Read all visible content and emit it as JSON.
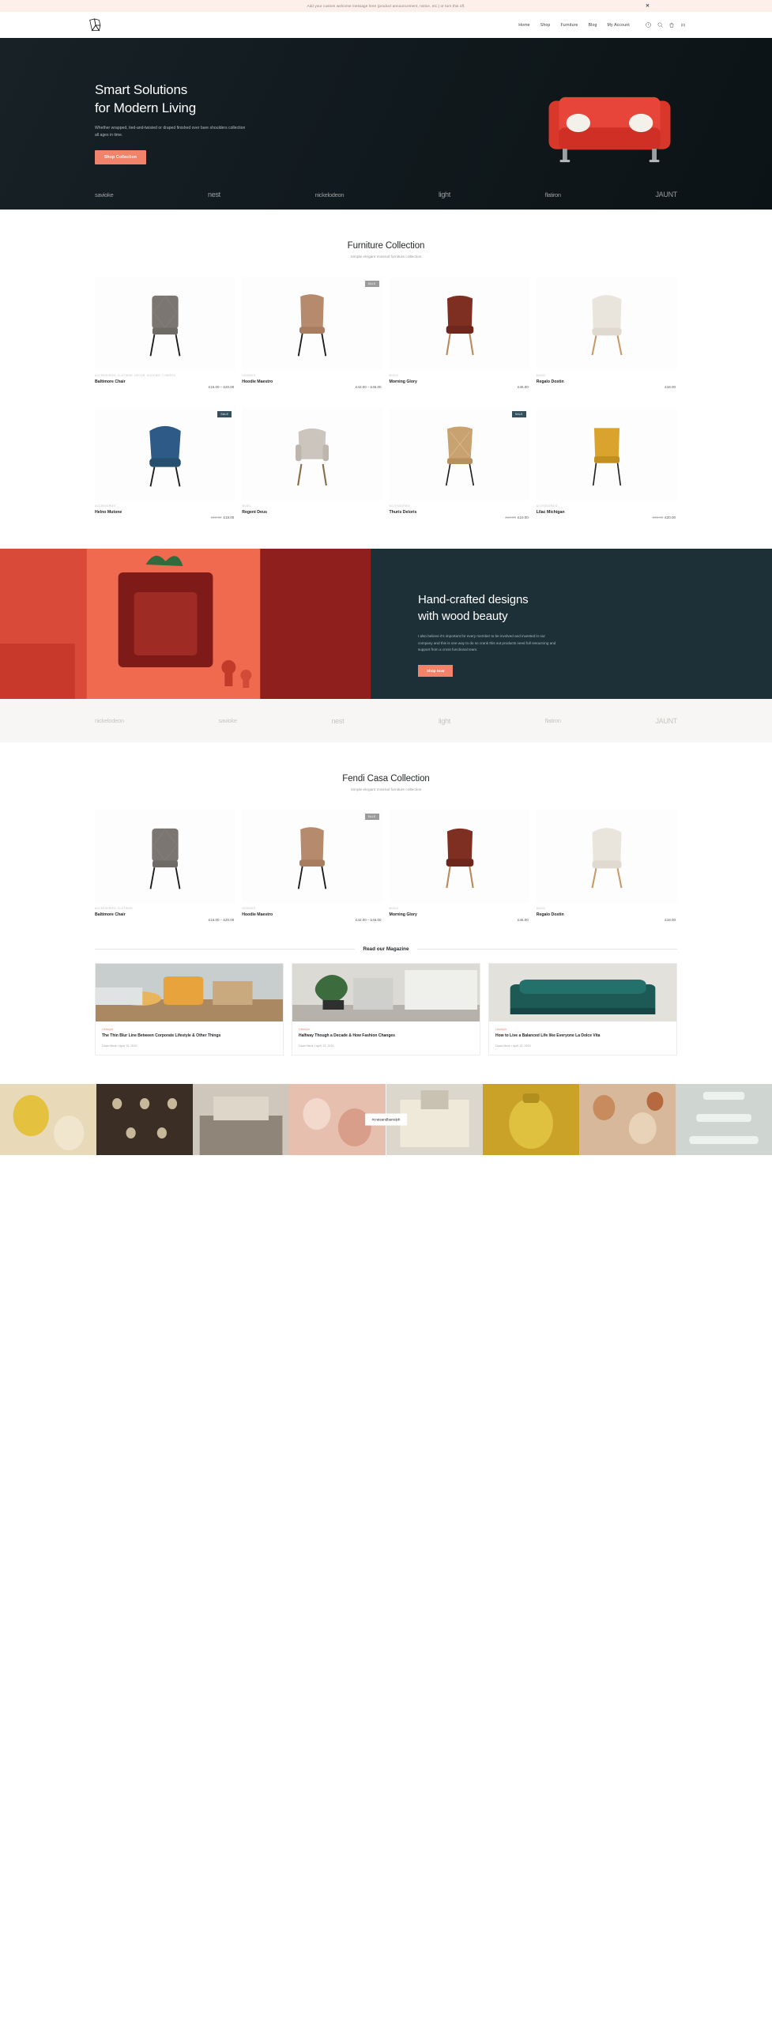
{
  "announcement": {
    "text": "Add your custom welcome message here (product announcement, notice, etc.) or turn this off.",
    "close_label": "✕"
  },
  "header": {
    "logo_name": "brand-logo",
    "nav": [
      {
        "label": "Home"
      },
      {
        "label": "Shop"
      },
      {
        "label": "Furniture"
      },
      {
        "label": "Blog"
      },
      {
        "label": "My Account"
      }
    ],
    "icons": [
      {
        "name": "help-icon"
      },
      {
        "name": "search-icon"
      },
      {
        "name": "cart-icon"
      }
    ],
    "cart_count": "(0)"
  },
  "hero": {
    "title_line1": "Smart Solutions",
    "title_line2": "for Modern Living",
    "subtitle": "Whether wrapped, tied-and-twisted or draped finished over bare shoulders collection all ages in time.",
    "button": "Shop Collection",
    "brands": [
      "savioke",
      "nest",
      "nickelodeon",
      "light",
      "flatiron",
      "JAUNT"
    ]
  },
  "collection1": {
    "title": "Furniture Collection",
    "subtitle": "Simple elegant minimal furniture collection",
    "products": [
      {
        "category": "ACCESSORIES, CLOTHING, DECOR, HOODIES, T-SHIRTS",
        "name": "Baltimore Chair",
        "price": "£15.00 – £20.00",
        "old_price": "",
        "badge": ""
      },
      {
        "category": "HOODIES",
        "name": "Hoodie Maestro",
        "price": "£42.00 – £45.00",
        "old_price": "",
        "badge": "SALE"
      },
      {
        "category": "MUSIC",
        "name": "Morning Glory",
        "price": "£45.00",
        "old_price": "",
        "badge": ""
      },
      {
        "category": "MUSIC",
        "name": "Regalo Dostin",
        "price": "£18.00",
        "old_price": "",
        "badge": ""
      },
      {
        "category": "ACCESSORIES",
        "name": "Helno Mutone",
        "price": "£18.00",
        "old_price": "£20.00",
        "badge": "SALE"
      },
      {
        "category": "MUSIC",
        "name": "Regent Deus",
        "price": "",
        "old_price": "",
        "badge": ""
      },
      {
        "category": "ACCESSORIES",
        "name": "Thuris Deloris",
        "price": "£10.00",
        "old_price": "£18.00",
        "badge": "SALE"
      },
      {
        "category": "ACCESSORIES",
        "name": "Lilac Michigan",
        "price": "£20.00",
        "old_price": "£60.00",
        "badge": ""
      }
    ]
  },
  "feature": {
    "title_line1": "Hand-crafted designs",
    "title_line2": "with wood beauty",
    "paragraph": "I also believe it's important for every member to be involved and invested in our company and this is one way to do so crank this out products need full resourcing and support from a cross functional team.",
    "button": "Shop Now"
  },
  "brands_light": [
    "nickelodeon",
    "savioke",
    "nest",
    "light",
    "flatiron",
    "JAUNT"
  ],
  "collection2": {
    "title": "Fendi Casa Collection",
    "subtitle": "Simple elegant minimal furniture collection",
    "products": [
      {
        "category": "ACCESSORIES, CLOTHING",
        "name": "Baltimore Chair",
        "price": "£15.00 – £20.00",
        "old_price": "",
        "badge": ""
      },
      {
        "category": "HOODIES",
        "name": "Hoodie Maestro",
        "price": "£42.00 – £45.00",
        "old_price": "",
        "badge": "SALE"
      },
      {
        "category": "MUSIC",
        "name": "Morning Glory",
        "price": "£45.00",
        "old_price": "",
        "badge": ""
      },
      {
        "category": "MUSIC",
        "name": "Regalo Dostin",
        "price": "£18.00",
        "old_price": "",
        "badge": ""
      }
    ]
  },
  "magazine": {
    "title": "Read our Magazine",
    "posts": [
      {
        "category": "Lifestyle",
        "title": "The Thin Blur Line Between Corporate Lifestyle & Other Things",
        "author": "David Beck",
        "date": "April 13, 2019",
        "separator": "•"
      },
      {
        "category": "Lifestyle",
        "title": "Halfway Though a Decade & How Fashion Changes",
        "author": "David Beck",
        "date": "April 13, 2019",
        "separator": "•"
      },
      {
        "category": "Lifestyle",
        "title": "How to Live a Balanced Life like Everyone La Dolce Vita",
        "author": "David Beck",
        "date": "April 13, 2019",
        "separator": "•"
      }
    ]
  },
  "instagram": {
    "tag": "#crateandbarrelph"
  },
  "colors": {
    "accent": "#f2836b",
    "dark": "#1d3038",
    "announce_bg": "#fdf0ea",
    "sale_badge": "#35505c"
  }
}
